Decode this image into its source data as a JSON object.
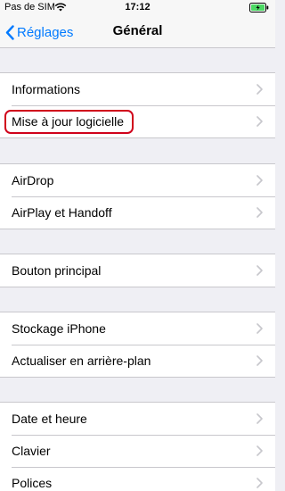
{
  "status_bar": {
    "carrier": "Pas de SIM",
    "time": "17:12",
    "wifi_icon": "wifi-icon",
    "battery_icon": "battery-charging-icon",
    "battery_color": "#4cd964"
  },
  "nav": {
    "back_label": "Réglages",
    "title": "Général",
    "accent_color": "#007aff"
  },
  "groups": [
    {
      "items": [
        "Informations",
        "Mise à jour logicielle"
      ]
    },
    {
      "items": [
        "AirDrop",
        "AirPlay et Handoff"
      ]
    },
    {
      "items": [
        "Bouton principal"
      ]
    },
    {
      "items": [
        "Stockage iPhone",
        "Actualiser en arrière-plan"
      ]
    },
    {
      "items": [
        "Date et heure",
        "Clavier",
        "Polices"
      ]
    }
  ],
  "highlighted_item": "Mise à jour logicielle",
  "highlight_color": "#d0021b"
}
